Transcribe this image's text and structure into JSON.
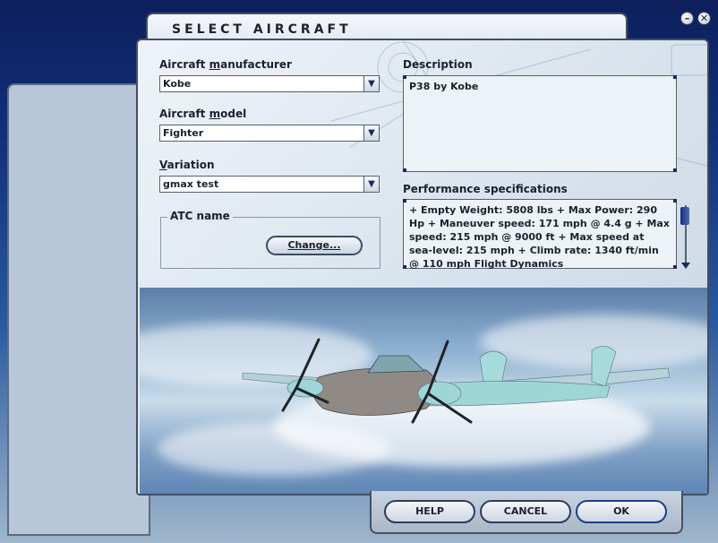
{
  "window": {
    "title": "SELECT AIRCRAFT",
    "minimize_symbol": "–",
    "close_symbol": "✕"
  },
  "form": {
    "manufacturer_label_pre": "Aircraft ",
    "manufacturer_label_ul": "m",
    "manufacturer_label_post": "anufacturer",
    "manufacturer_value": "Kobe",
    "model_label_pre": "Aircraft ",
    "model_label_ul": "m",
    "model_label_post": "odel",
    "model_value": "Fighter",
    "variation_label_ul": "V",
    "variation_label_post": "ariation",
    "variation_value": "gmax test",
    "atc_group_label": "ATC name",
    "change_button": "Change..."
  },
  "description": {
    "label": "Description",
    "text": "P38 by Kobe"
  },
  "performance": {
    "label": "Performance specifications",
    "text": "+ Empty Weight: 5808 lbs + Max Power: 290 Hp + Maneuver speed: 171 mph @ 4.4 g + Max speed: 215 mph @ 9000 ft + Max speed at sea-level: 215 mph + Climb rate: 1340 ft/min @ 110 mph Flight Dynamics"
  },
  "buttons": {
    "help": "HELP",
    "cancel": "CANCEL",
    "ok": "OK"
  },
  "colors": {
    "accent": "#1c2f7a",
    "aircraft_body": "#8aa7b0",
    "aircraft_nacelle": "#9ed6d8"
  },
  "icons": {
    "dropdown_arrow": "▼"
  }
}
